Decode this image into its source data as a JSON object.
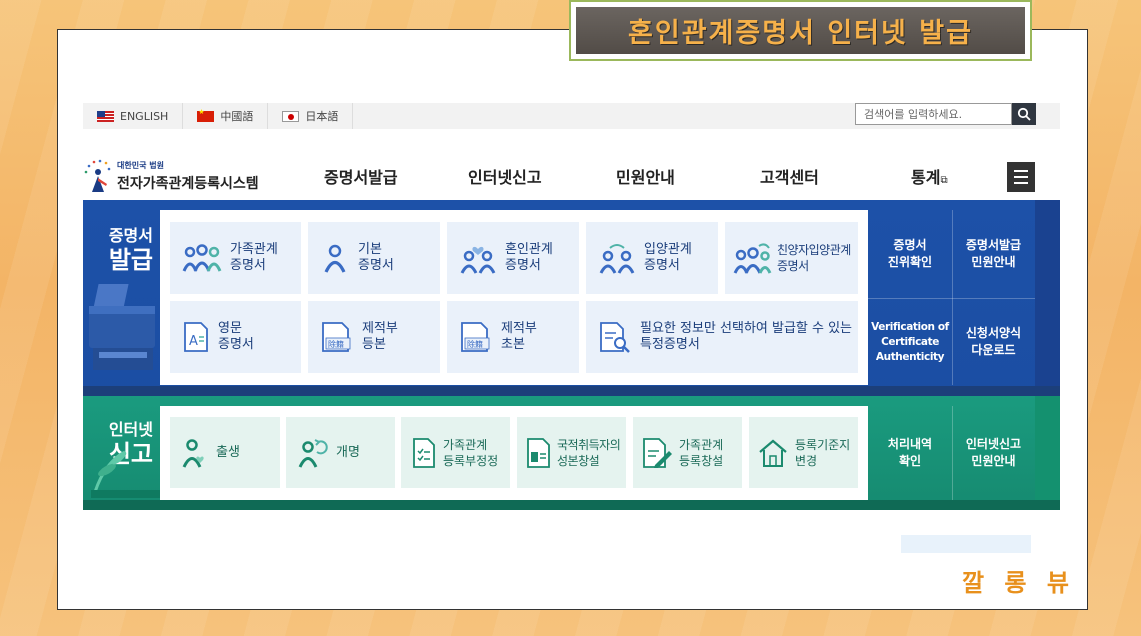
{
  "banner": {
    "title": "혼인관계증명서 인터넷 발급"
  },
  "topbar": {
    "languages": [
      {
        "label": "ENGLISH",
        "flag": "us-flag"
      },
      {
        "label": "中國語",
        "flag": "cn-flag"
      },
      {
        "label": "日本語",
        "flag": "jp-flag"
      }
    ],
    "search_placeholder": "검색어를 입력하세요."
  },
  "logo": {
    "small": "대한민국 법원",
    "big": "전자가족관계등록시스템"
  },
  "nav": {
    "items": [
      "증명서발급",
      "인터넷신고",
      "민원안내",
      "고객센터",
      "통계"
    ],
    "external_icon": "⧉"
  },
  "certificates": {
    "title_line1": "증명서",
    "title_line2": "발급",
    "tiles": [
      {
        "label": "가족관계\n증명서",
        "icon": "family-icon"
      },
      {
        "label": "기본\n증명서",
        "icon": "person-icon"
      },
      {
        "label": "혼인관계\n증명서",
        "icon": "couple-heart-icon"
      },
      {
        "label": "입양관계\n증명서",
        "icon": "adoption-icon"
      },
      {
        "label": "친양자입양관계\n증명서",
        "icon": "family-adoption-icon"
      },
      {
        "label": "영문\n증명서",
        "icon": "english-doc-icon"
      },
      {
        "label": "제적부\n등본",
        "icon": "removed-register-icon"
      },
      {
        "label": "제적부\n초본",
        "icon": "removed-register-icon"
      },
      {
        "label": "필요한 정보만 선택하여 발급할 수 있는\n특정증명서",
        "icon": "search-doc-icon"
      }
    ],
    "tag_label": "除籍",
    "doc_letter": "A",
    "side_links": [
      {
        "label": "증명서\n진위확인"
      },
      {
        "label": "증명서발급\n민원안내"
      },
      {
        "label": "Verification of\nCertificate\nAuthenticity"
      },
      {
        "label": "신청서양식\n다운로드"
      }
    ]
  },
  "reports": {
    "title_line1": "인터넷",
    "title_line2": "신고",
    "tiles": [
      {
        "label": "출생",
        "icon": "birth-icon"
      },
      {
        "label": "개명",
        "icon": "rename-icon"
      },
      {
        "label": "가족관계\n등록부정정",
        "icon": "checklist-doc-icon"
      },
      {
        "label": "국적취득자의\n성본창설",
        "icon": "id-doc-icon"
      },
      {
        "label": "가족관계\n등록창설",
        "icon": "edit-doc-icon"
      },
      {
        "label": "등록기준지\n변경",
        "icon": "house-icon"
      }
    ],
    "side_links": [
      {
        "label": "처리내역\n확인"
      },
      {
        "label": "인터넷신고\n민원안내"
      }
    ]
  },
  "watermark": "깔 롱 뷰",
  "colors": {
    "blue": "#1d51a8",
    "green": "#1a9b7f",
    "banner_text": "#f6b14a"
  }
}
